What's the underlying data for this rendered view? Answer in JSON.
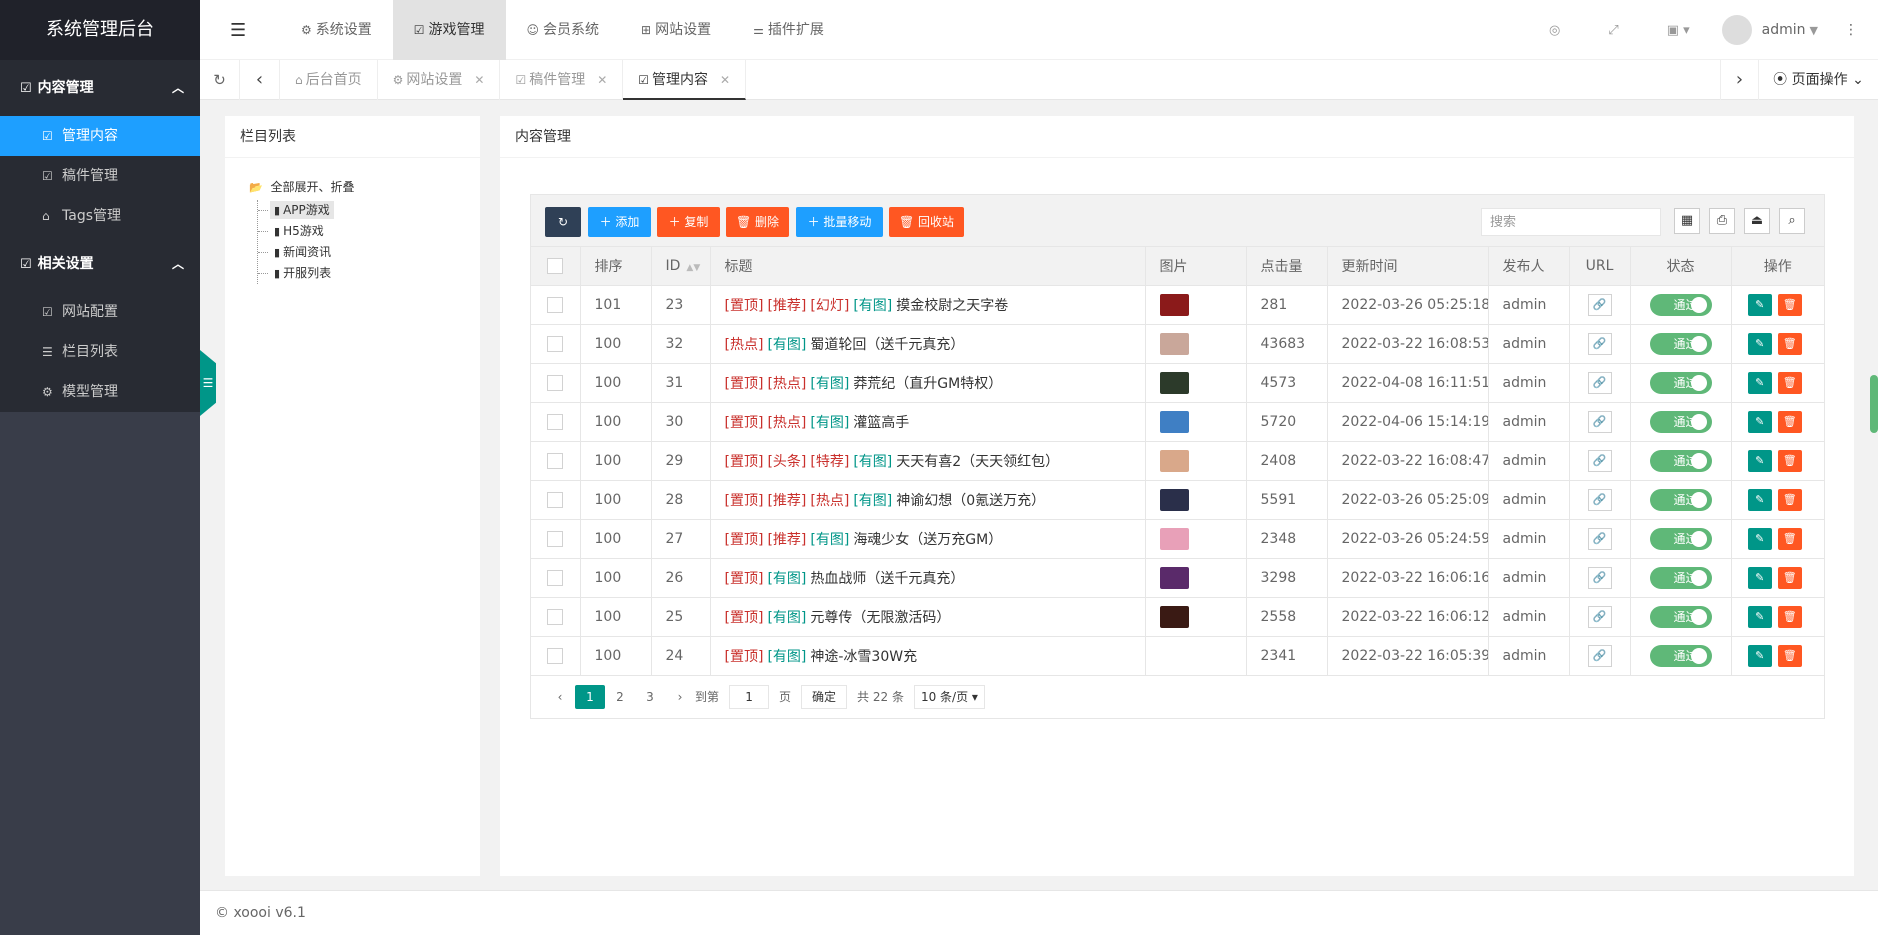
{
  "app_title": "系统管理后台",
  "sidebar": {
    "groups": [
      {
        "title": "内容管理",
        "items": [
          {
            "label": "管理内容",
            "active": true
          },
          {
            "label": "稿件管理"
          },
          {
            "label": "Tags管理"
          }
        ]
      },
      {
        "title": "相关设置",
        "items": [
          {
            "label": "网站配置"
          },
          {
            "label": "栏目列表"
          },
          {
            "label": "模型管理"
          }
        ]
      }
    ]
  },
  "top_nav": [
    {
      "label": "系统设置"
    },
    {
      "label": "游戏管理",
      "active": true
    },
    {
      "label": "会员系统"
    },
    {
      "label": "网站设置"
    },
    {
      "label": "插件扩展"
    }
  ],
  "user": {
    "name": "admin"
  },
  "tabs": [
    {
      "label": "后台首页"
    },
    {
      "label": "网站设置"
    },
    {
      "label": "稿件管理"
    },
    {
      "label": "管理内容",
      "active": true
    }
  ],
  "page_ops_label": "页面操作",
  "tree_panel": {
    "title": "栏目列表",
    "root": "全部展开、折叠",
    "nodes": [
      "APP游戏",
      "H5游戏",
      "新闻资讯",
      "开服列表"
    ]
  },
  "content_panel": {
    "title": "内容管理",
    "toolbar": {
      "add": "添加",
      "copy": "复制",
      "delete": "删除",
      "batch_move": "批量移动",
      "recycle": "回收站",
      "search_placeholder": "搜索"
    },
    "columns": [
      "排序",
      "ID",
      "标题",
      "图片",
      "点击量",
      "更新时间",
      "发布人",
      "URL",
      "状态",
      "操作"
    ],
    "rows": [
      {
        "sort": "101",
        "id": "23",
        "tags": [
          "[置顶]",
          "[推荐]",
          "[幻灯]"
        ],
        "green_tags": [
          "[有图]"
        ],
        "title": "摸金校尉之天字卷",
        "img": "#8b1a1a",
        "clicks": "281",
        "time": "2022-03-26 05:25:18",
        "author": "admin",
        "status": "通过"
      },
      {
        "sort": "100",
        "id": "32",
        "tags": [
          "[热点]"
        ],
        "green_tags": [
          "[有图]"
        ],
        "title": "蜀道轮回（送千元真充）",
        "img": "#c9a79a",
        "clicks": "43683",
        "time": "2022-03-22 16:08:53",
        "author": "admin",
        "status": "通过"
      },
      {
        "sort": "100",
        "id": "31",
        "tags": [
          "[置顶]",
          "[热点]"
        ],
        "green_tags": [
          "[有图]"
        ],
        "title": "莽荒纪（直升GM特权）",
        "img": "#2c3a2a",
        "clicks": "4573",
        "time": "2022-04-08 16:11:51",
        "author": "admin",
        "status": "通过"
      },
      {
        "sort": "100",
        "id": "30",
        "tags": [
          "[置顶]",
          "[热点]"
        ],
        "green_tags": [
          "[有图]"
        ],
        "title": "灌篮高手",
        "img": "#3f7fc4",
        "clicks": "5720",
        "time": "2022-04-06 15:14:19",
        "author": "admin",
        "status": "通过"
      },
      {
        "sort": "100",
        "id": "29",
        "tags": [
          "[置顶]",
          "[头条]",
          "[特荐]"
        ],
        "green_tags": [
          "[有图]"
        ],
        "title": "天天有喜2（天天领红包）",
        "img": "#d9a88a",
        "clicks": "2408",
        "time": "2022-03-22 16:08:47",
        "author": "admin",
        "status": "通过"
      },
      {
        "sort": "100",
        "id": "28",
        "tags": [
          "[置顶]",
          "[推荐]",
          "[热点]"
        ],
        "green_tags": [
          "[有图]"
        ],
        "title": "神谕幻想（0氪送万充）",
        "img": "#2a2f4a",
        "clicks": "5591",
        "time": "2022-03-26 05:25:09",
        "author": "admin",
        "status": "通过"
      },
      {
        "sort": "100",
        "id": "27",
        "tags": [
          "[置顶]",
          "[推荐]"
        ],
        "green_tags": [
          "[有图]"
        ],
        "title": "海魂少女（送万充GM）",
        "img": "#e8a0b8",
        "clicks": "2348",
        "time": "2022-03-26 05:24:59",
        "author": "admin",
        "status": "通过"
      },
      {
        "sort": "100",
        "id": "26",
        "tags": [
          "[置顶]"
        ],
        "green_tags": [
          "[有图]"
        ],
        "title": "热血战师（送千元真充）",
        "img": "#5a2a6a",
        "clicks": "3298",
        "time": "2022-03-22 16:06:16",
        "author": "admin",
        "status": "通过"
      },
      {
        "sort": "100",
        "id": "25",
        "tags": [
          "[置顶]"
        ],
        "green_tags": [
          "[有图]"
        ],
        "title": "元尊传（无限激活码）",
        "img": "#3a1a14",
        "clicks": "2558",
        "time": "2022-03-22 16:06:12",
        "author": "admin",
        "status": "通过"
      },
      {
        "sort": "100",
        "id": "24",
        "tags": [
          "[置顶]"
        ],
        "green_tags": [
          "[有图]"
        ],
        "title": "神途-冰雪30W充",
        "img": "",
        "clicks": "2341",
        "time": "2022-03-22 16:05:39",
        "author": "admin",
        "status": "通过"
      }
    ],
    "pager": {
      "pages": [
        "1",
        "2",
        "3"
      ],
      "current": "1",
      "goto_label": "到第",
      "goto_value": "1",
      "page_unit": "页",
      "confirm": "确定",
      "total": "共 22 条",
      "page_size": "10 条/页"
    }
  },
  "footer": "© xoooi v6.1",
  "colors": {
    "accent": "#1e9fff",
    "primary": "#009688",
    "danger": "#ff5722",
    "sidebar": "#393d49"
  }
}
